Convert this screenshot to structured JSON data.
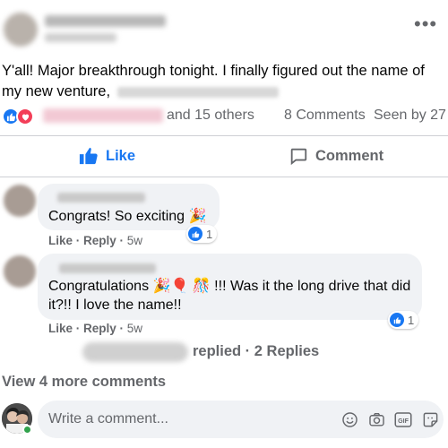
{
  "post": {
    "text": "Y'all! Major breakthrough tonight. I finally figured out the name of my new venture,",
    "more_icon": "•••",
    "reactions": {
      "icons": [
        "like-icon",
        "love-icon"
      ],
      "others_text": "and 15 others",
      "comments_count": "8 Comments",
      "seen_by": "Seen by 27"
    }
  },
  "actions": {
    "like_label": "Like",
    "comment_label": "Comment"
  },
  "comments": [
    {
      "text": "Congrats! So exciting 🎉",
      "like_label": "Like",
      "reply_label": "Reply",
      "time": "5w",
      "reaction_count": "1"
    },
    {
      "text": "Congratulations 🎉🎈 🎊 !!! Was it the long drive that did it?!! I love the name!!",
      "like_label": "Like",
      "reply_label": "Reply",
      "time": "5w",
      "reaction_count": "1",
      "replies_text": "replied · 2 Replies"
    }
  ],
  "view_more": "View 4 more comments",
  "composer": {
    "placeholder": "Write a comment...",
    "tools": [
      "emoji-icon",
      "camera-icon",
      "gif-icon",
      "sticker-icon"
    ]
  },
  "colors": {
    "accent": "#1877f2",
    "love": "#f33e58",
    "muted": "#65676b",
    "bubble": "#f0f2f5",
    "online": "#31a24c"
  }
}
